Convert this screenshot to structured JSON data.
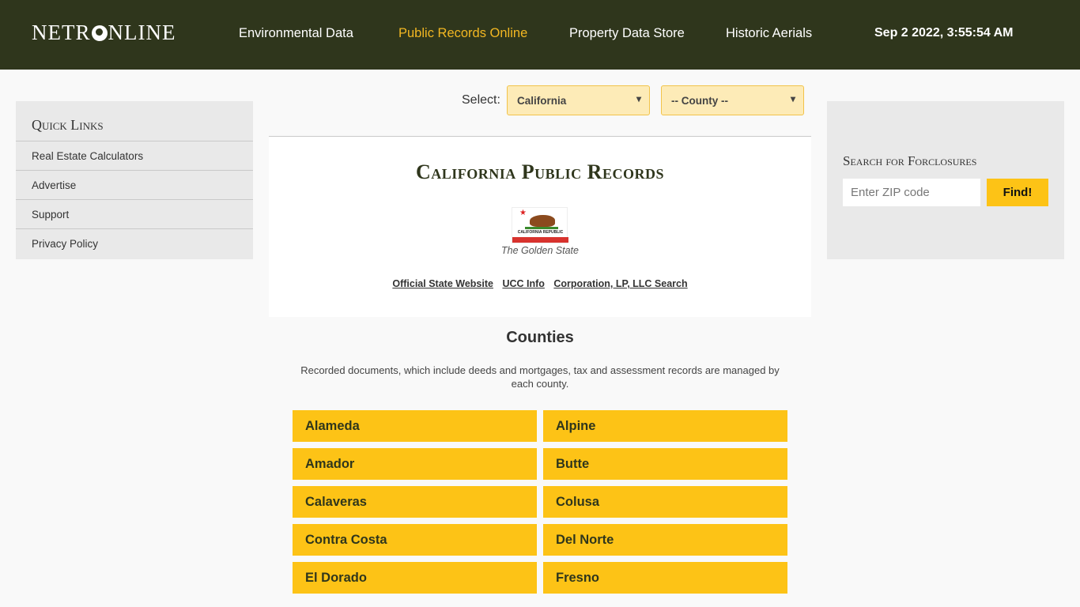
{
  "header": {
    "logo": {
      "left": "NETR",
      "right": "NLINE"
    },
    "nav": [
      {
        "label": "Environmental Data",
        "active": false
      },
      {
        "label": "Public Records Online",
        "active": true
      },
      {
        "label": "Property Data Store",
        "active": false
      },
      {
        "label": "Historic Aerials",
        "active": false
      }
    ],
    "datetime": "Sep 2 2022, 3:55:54 AM"
  },
  "sidebar": {
    "title": "Quick Links",
    "items": [
      {
        "label": "Real Estate Calculators"
      },
      {
        "label": "Advertise"
      },
      {
        "label": "Support"
      },
      {
        "label": "Privacy Policy"
      }
    ]
  },
  "selector": {
    "label": "Select:",
    "state_value": "California",
    "county_value": "-- County --",
    "chevron": "▾"
  },
  "state": {
    "title": "California Public Records",
    "flag_caption": "CALIFORNIA REPUBLIC",
    "nickname": "The Golden State",
    "links": [
      {
        "label": "Official State Website"
      },
      {
        "label": "UCC Info"
      },
      {
        "label": "Corporation, LP, LLC Search"
      }
    ]
  },
  "counties": {
    "title": "Counties",
    "description": "Recorded documents, which include deeds and mortgages, tax and assessment records are managed by each county.",
    "items": [
      "Alameda",
      "Alpine",
      "Amador",
      "Butte",
      "Calaveras",
      "Colusa",
      "Contra Costa",
      "Del Norte",
      "El Dorado",
      "Fresno"
    ]
  },
  "foreclosure": {
    "title": "Search for Forclosures",
    "zip_placeholder": "Enter ZIP code",
    "zip_value": "",
    "button": "Find!"
  },
  "colors": {
    "header_bg": "#2f361c",
    "accent": "#fdc316",
    "active_nav": "#f2b722"
  }
}
